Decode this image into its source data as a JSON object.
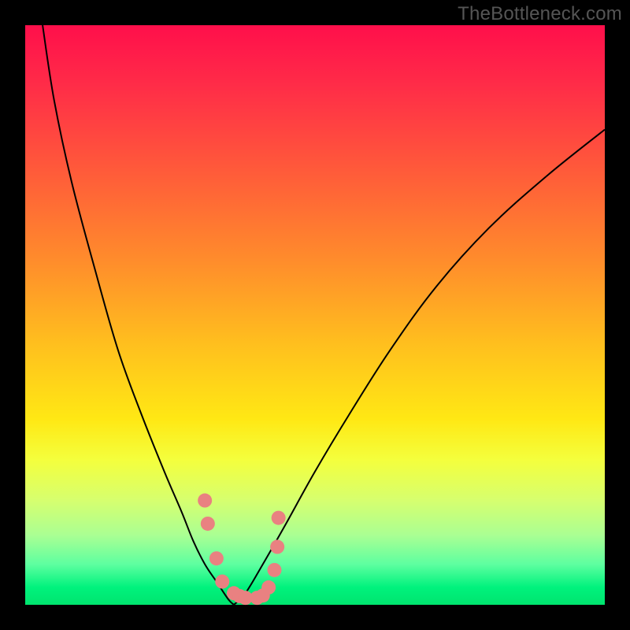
{
  "watermark": "TheBottleneck.com",
  "colors": {
    "frame_bg": "#000000",
    "gradient_top": "#ff0f4b",
    "gradient_bottom": "#00e46e",
    "curve": "#000000",
    "dots": "#e98181",
    "watermark": "#555555"
  },
  "chart_data": {
    "type": "line",
    "title": "",
    "xlabel": "",
    "ylabel": "",
    "xlim": [
      0,
      100
    ],
    "ylim": [
      0,
      100
    ],
    "grid": false,
    "annotations": [
      "TheBottleneck.com"
    ],
    "series": [
      {
        "name": "left-branch-curve",
        "x": [
          3,
          5,
          8,
          12,
          16,
          20,
          24,
          27,
          29,
          31,
          33,
          35,
          36
        ],
        "y": [
          100,
          87,
          73,
          58,
          44,
          33,
          23,
          16,
          11,
          7,
          4,
          1,
          0
        ]
      },
      {
        "name": "right-branch-curve",
        "x": [
          36,
          38,
          41,
          45,
          50,
          56,
          63,
          71,
          80,
          90,
          100
        ],
        "y": [
          0,
          2,
          7,
          14,
          23,
          33,
          44,
          55,
          65,
          74,
          82
        ]
      },
      {
        "name": "fit-dots",
        "type": "scatter",
        "x": [
          31,
          31.5,
          33,
          34,
          36,
          37,
          38,
          40,
          41,
          42,
          43,
          43.5,
          43.7
        ],
        "y": [
          18,
          14,
          8,
          4,
          2,
          1.5,
          1.2,
          1.2,
          1.6,
          3,
          6,
          10,
          15
        ]
      }
    ]
  }
}
